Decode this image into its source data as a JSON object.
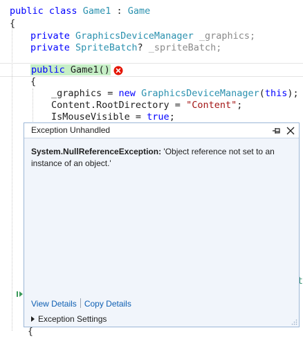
{
  "editor": {
    "lines": {
      "class_decl": {
        "kw1": "public",
        "kw2": "class",
        "name": "Game1",
        "sep": " : ",
        "base": "Game"
      },
      "open_brace_1": "{",
      "field_graphics": {
        "kw": "private",
        "type": "GraphicsDeviceManager",
        "name": "_graphics;"
      },
      "field_sprite": {
        "kw": "private",
        "type": "SpriteBatch",
        "q": "?",
        "name": "_spriteBatch;"
      },
      "ctor": {
        "kw": "public",
        "name": "Game1()"
      },
      "open_brace_2": "{",
      "stmt_graphics": {
        "lhs": "_graphics = ",
        "kw_new": "new",
        "type": "GraphicsDeviceManager",
        "arg_open": "(",
        "kw_this": "this",
        "arg_close": ");"
      },
      "stmt_content": {
        "lhs": "Content.RootDirectory = ",
        "str": "\"Content\"",
        "end": ";"
      },
      "stmt_mouse": {
        "lhs": "IsMouseVisible = ",
        "kw": "true",
        "end": ";"
      }
    },
    "partial_char": "t",
    "stub_brace": "{",
    "status_icon": "error-icon"
  },
  "popup": {
    "title": "Exception Unhandled",
    "exception_name": "System.NullReferenceException:",
    "exception_message": "'Object reference not set to an instance of an object.'",
    "links": {
      "view_details": "View Details",
      "copy_details": "Copy Details"
    },
    "settings_label": "Exception Settings"
  },
  "colors": {
    "keyword": "#0000ff",
    "type": "#2b91af",
    "string": "#a31515",
    "highlight": "#c6efc6",
    "error": "#e51400",
    "popup_border": "#9bb6d6",
    "popup_bg": "#f1f5fb",
    "link": "#0e5fb3"
  }
}
